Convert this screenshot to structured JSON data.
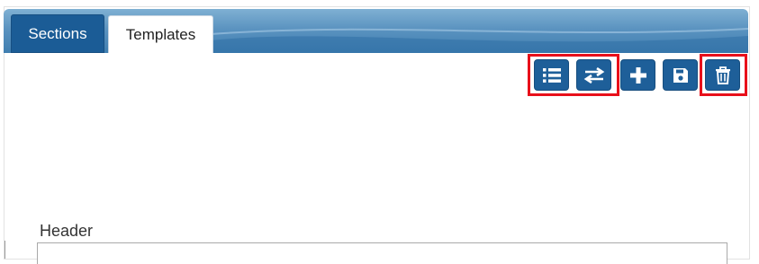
{
  "tabs": [
    {
      "label": "Sections",
      "active": true
    },
    {
      "label": "Templates",
      "active": false
    }
  ],
  "toolbar": {
    "buttons": [
      {
        "icon": "list-icon",
        "highlighted": true
      },
      {
        "icon": "swap-arrows-icon",
        "highlighted": true
      },
      {
        "icon": "plus-icon",
        "highlighted": false
      },
      {
        "icon": "save-icon",
        "highlighted": false
      },
      {
        "icon": "trash-icon",
        "highlighted": true
      }
    ]
  },
  "form": {
    "header_label": "Header",
    "header_value": ""
  },
  "colors": {
    "primary": "#1e5f99",
    "tabbar": "#5b93c0",
    "highlight": "#e8101a"
  }
}
